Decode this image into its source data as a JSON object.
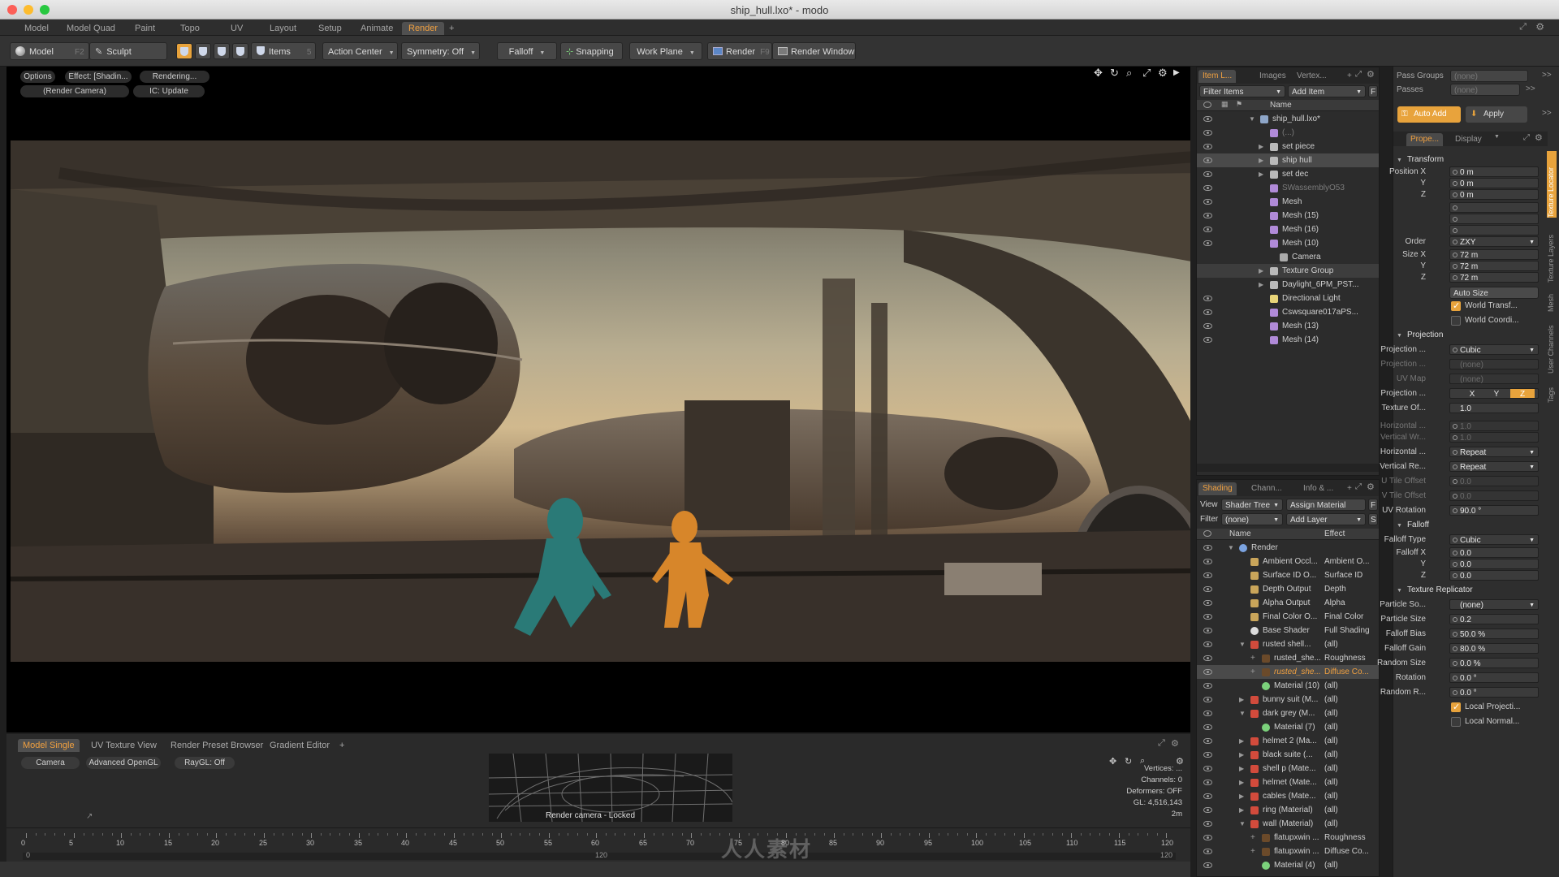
{
  "window": {
    "title": "ship_hull.lxo* - modo"
  },
  "layout_tabs": [
    "Model",
    "Model Quad",
    "Paint",
    "Topo",
    "UV",
    "Layout",
    "Setup",
    "Animate",
    "Render"
  ],
  "active_layout_tab": "Render",
  "add_tab_glyph": "+",
  "toolbar": {
    "model": "Model",
    "model_key": "F2",
    "sculpt": "Sculpt",
    "items": "Items",
    "items_key": "5",
    "action_center": "Action Center",
    "symmetry": "Symmetry: Off",
    "falloff": "Falloff",
    "snapping": "Snapping",
    "work_plane": "Work Plane",
    "render": "Render",
    "render_key": "F9",
    "render_window": "Render Window"
  },
  "viewport": {
    "options": "Options",
    "effect": "Effect: [Shadin...",
    "rendering": "Rendering...",
    "camera": "(Render Camera)",
    "ic_update": "IC: Update"
  },
  "bottom_viewport": {
    "tabs": [
      "Model Single",
      "UV Texture View",
      "Render Preset Browser",
      "Gradient Editor"
    ],
    "active_tab": "Model Single",
    "camera": "Camera",
    "gl": "Advanced OpenGL",
    "ray_gl": "RayGL: Off",
    "caption": "Render camera - Locked",
    "stats": [
      "Vertices: ...",
      "Channels: 0",
      "Deformers: OFF",
      "GL: 4,516,143",
      "2m"
    ]
  },
  "timeline": {
    "ticks": [
      0,
      5,
      10,
      15,
      20,
      25,
      30,
      35,
      40,
      45,
      50,
      55,
      60,
      65,
      70,
      75,
      80,
      85,
      90,
      95,
      100,
      105,
      110,
      115,
      120
    ],
    "sub_labels": [
      "0",
      "120",
      "120"
    ]
  },
  "item_panel": {
    "tabs": [
      "Item L...",
      "Images",
      "Vertex..."
    ],
    "filter": "Filter Items",
    "add_item": "Add Item",
    "f_button": "F",
    "column": "Name",
    "items": [
      {
        "name": "ship_hull.lxo*",
        "dim": false,
        "level": 0,
        "tw": "▼",
        "icon": "scene",
        "eye": true
      },
      {
        "name": "(...)",
        "dim": true,
        "level": 1,
        "tw": "",
        "icon": "mesh",
        "eye": true
      },
      {
        "name": "set piece",
        "dim": false,
        "level": 1,
        "tw": "▶",
        "icon": "group",
        "eye": true
      },
      {
        "name": "ship hull",
        "dim": false,
        "level": 1,
        "tw": "▶",
        "icon": "group",
        "eye": true,
        "selected": true
      },
      {
        "name": "set dec",
        "dim": false,
        "level": 1,
        "tw": "▶",
        "icon": "group",
        "eye": true
      },
      {
        "name": "SWassemblyO53",
        "dim": true,
        "level": 1,
        "tw": "",
        "icon": "mesh",
        "eye": true
      },
      {
        "name": "Mesh",
        "dim": false,
        "level": 1,
        "tw": "",
        "icon": "mesh",
        "eye": true
      },
      {
        "name": "Mesh (15)",
        "dim": false,
        "level": 1,
        "tw": "",
        "icon": "mesh",
        "eye": true
      },
      {
        "name": "Mesh (16)",
        "dim": false,
        "level": 1,
        "tw": "",
        "icon": "mesh",
        "eye": true
      },
      {
        "name": "Mesh (10)",
        "dim": false,
        "level": 1,
        "tw": "",
        "icon": "mesh",
        "eye": true
      },
      {
        "name": "Camera",
        "dim": false,
        "level": 2,
        "tw": "",
        "icon": "camera",
        "eye": false
      },
      {
        "name": "Texture Group",
        "dim": false,
        "level": 1,
        "tw": "▶",
        "icon": "group",
        "eye": false,
        "highlight": true
      },
      {
        "name": "Daylight_6PM_PST...",
        "dim": false,
        "level": 1,
        "tw": "▶",
        "icon": "group",
        "eye": false
      },
      {
        "name": "Directional Light",
        "dim": false,
        "level": 1,
        "tw": "",
        "icon": "light",
        "eye": true
      },
      {
        "name": "Cswsquare017aPS...",
        "dim": false,
        "level": 1,
        "tw": "",
        "icon": "mesh",
        "eye": true
      },
      {
        "name": "Mesh (13)",
        "dim": false,
        "level": 1,
        "tw": "",
        "icon": "mesh",
        "eye": true
      },
      {
        "name": "Mesh (14)",
        "dim": false,
        "level": 1,
        "tw": "",
        "icon": "mesh",
        "eye": true
      }
    ]
  },
  "shading_panel": {
    "tabs": [
      "Shading",
      "Chann...",
      "Info & ..."
    ],
    "view_label": "View",
    "view_value": "Shader Tree",
    "assign_material": "Assign Material",
    "f_button": "F",
    "filter_label": "Filter",
    "filter_value": "(none)",
    "add_layer": "Add Layer",
    "s_button": "S",
    "col_name": "Name",
    "col_effect": "Effect",
    "layers": [
      {
        "name": "Render",
        "effect": "",
        "level": 0,
        "tw": "▼",
        "icon": "render"
      },
      {
        "name": "Ambient Occl...",
        "effect": "Ambient O...",
        "level": 1,
        "tw": "",
        "icon": "output"
      },
      {
        "name": "Surface ID O...",
        "effect": "Surface ID",
        "level": 1,
        "tw": "",
        "icon": "output"
      },
      {
        "name": "Depth Output",
        "effect": "Depth",
        "level": 1,
        "tw": "",
        "icon": "output"
      },
      {
        "name": "Alpha Output",
        "effect": "Alpha",
        "level": 1,
        "tw": "",
        "icon": "output"
      },
      {
        "name": "Final Color O...",
        "effect": "Final Color",
        "level": 1,
        "tw": "",
        "icon": "output"
      },
      {
        "name": "Base Shader",
        "effect": "Full Shading",
        "level": 1,
        "tw": "",
        "icon": "shader"
      },
      {
        "name": "rusted shell...",
        "effect": "(all)",
        "level": 1,
        "tw": "▼",
        "icon": "mask"
      },
      {
        "name": "rusted_she...",
        "effect": "Roughness",
        "level": 2,
        "tw": "+",
        "icon": "image"
      },
      {
        "name": "rusted_she...",
        "effect": "Diffuse Co...",
        "level": 2,
        "tw": "+",
        "icon": "image",
        "selected": true
      },
      {
        "name": "Material (10)",
        "effect": "(all)",
        "level": 2,
        "tw": "",
        "icon": "material"
      },
      {
        "name": "bunny suit (M...",
        "effect": "(all)",
        "level": 1,
        "tw": "▶",
        "icon": "mask"
      },
      {
        "name": "dark grey (M...",
        "effect": "(all)",
        "level": 1,
        "tw": "▼",
        "icon": "mask"
      },
      {
        "name": "Material (7)",
        "effect": "(all)",
        "level": 2,
        "tw": "",
        "icon": "material"
      },
      {
        "name": "helmet 2 (Ma...",
        "effect": "(all)",
        "level": 1,
        "tw": "▶",
        "icon": "mask"
      },
      {
        "name": "black suite (...",
        "effect": "(all)",
        "level": 1,
        "tw": "▶",
        "icon": "mask"
      },
      {
        "name": "shell p (Mate...",
        "effect": "(all)",
        "level": 1,
        "tw": "▶",
        "icon": "mask"
      },
      {
        "name": "helmet (Mate...",
        "effect": "(all)",
        "level": 1,
        "tw": "▶",
        "icon": "mask"
      },
      {
        "name": "cables (Mate...",
        "effect": "(all)",
        "level": 1,
        "tw": "▶",
        "icon": "mask"
      },
      {
        "name": "ring (Material)",
        "effect": "(all)",
        "level": 1,
        "tw": "▶",
        "icon": "mask"
      },
      {
        "name": "wall (Material)",
        "effect": "(all)",
        "level": 1,
        "tw": "▼",
        "icon": "mask"
      },
      {
        "name": "flatupxwin ...",
        "effect": "Roughness",
        "level": 2,
        "tw": "+",
        "icon": "image"
      },
      {
        "name": "flatupxwin ...",
        "effect": "Diffuse Co...",
        "level": 2,
        "tw": "+",
        "icon": "image"
      },
      {
        "name": "Material (4)",
        "effect": "(all)",
        "level": 2,
        "tw": "",
        "icon": "material"
      }
    ]
  },
  "properties": {
    "pass_groups": "Pass Groups",
    "pass_groups_value": "(none)",
    "passes": "Passes",
    "passes_value": "(none)",
    "auto_add": "Auto Add",
    "apply": "Apply",
    "tabs": [
      "Prope...",
      "Display"
    ],
    "side_tabs": [
      "Texture Locator",
      "Texture Layers",
      "Mesh",
      "User Channels",
      "Tags"
    ],
    "transform_header": "Transform",
    "position": {
      "x_label": "Position X",
      "y_label": "Y",
      "z_label": "Z",
      "x": "0 m",
      "y": "0 m",
      "z": "0 m"
    },
    "rotation": "0.0 °",
    "order": {
      "label": "Order",
      "value": "ZXY"
    },
    "size": {
      "x_label": "Size X",
      "y_label": "Y",
      "z_label": "Z",
      "x": "72 m",
      "y": "72 m",
      "z": "72 m"
    },
    "auto_size": "Auto Size",
    "world_transform": "World Transf...",
    "world_coord": "World Coordi...",
    "projection_header": "Projection",
    "projection_type_label": "Projection ...",
    "projection_type": "Cubic",
    "projection_image_label": "Projection ...",
    "projection_image": "(none)",
    "uv_map_label": "UV Map",
    "uv_map": "(none)",
    "projection_axis_label": "Projection ...",
    "axes": [
      "X",
      "Y",
      "Z"
    ],
    "texture_offset_label": "Texture Of...",
    "texture_offset": "1.0",
    "horizontal_wrap_label": "Horizontal ...",
    "horizontal_wrap": "1.0",
    "vertical_wrap_label": "Vertical Wr...",
    "vertical_wrap": "1.0",
    "horizontal_repeat_label": "Horizontal ...",
    "horizontal_repeat": "Repeat",
    "vertical_repeat_label": "Vertical Re...",
    "vertical_repeat": "Repeat",
    "u_tile_label": "U Tile Offset",
    "u_tile": "0.0",
    "v_tile_label": "V Tile Offset",
    "v_tile": "0.0",
    "uv_rotation_label": "UV Rotation",
    "uv_rotation": "90.0 °",
    "falloff_header": "Falloff",
    "falloff_type_label": "Falloff Type",
    "falloff_type": "Cubic",
    "falloff_x_label": "Falloff X",
    "falloff_y_label": "Y",
    "falloff_z_label": "Z",
    "falloff_x": "0.0",
    "falloff_y": "0.0",
    "falloff_z": "0.0",
    "replicator_header": "Texture Replicator",
    "particle_source_label": "Particle So...",
    "particle_source": "(none)",
    "particle_size_label": "Particle Size",
    "particle_size": "0.2",
    "falloff_bias_label": "Falloff Bias",
    "falloff_bias": "50.0 %",
    "falloff_gain_label": "Falloff Gain",
    "falloff_gain": "80.0 %",
    "random_size_label": "Random Size",
    "random_size": "0.0 %",
    "rotation_label": "Rotation",
    "random_r_label": "Random R...",
    "random_r": "0.0 °",
    "local_projection": "Local Projecti...",
    "local_normal": "Local Normal..."
  },
  "watermark": "人人素材"
}
